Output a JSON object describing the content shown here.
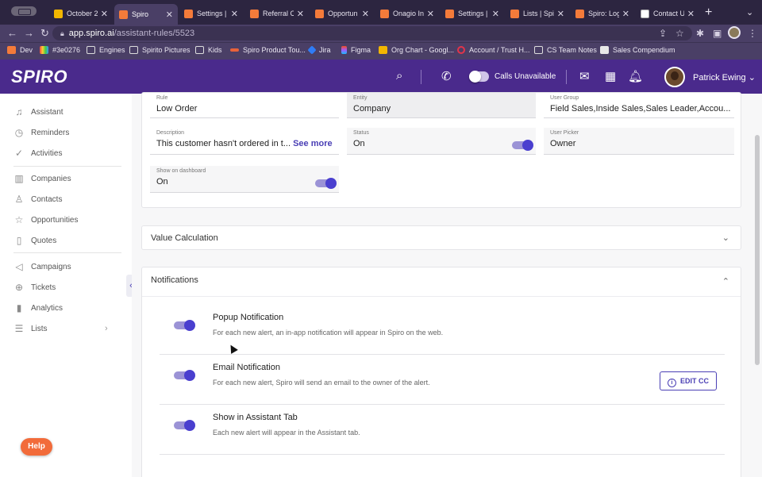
{
  "browser": {
    "tabs": [
      {
        "title": "October 2",
        "favicon": "gslide",
        "active": false
      },
      {
        "title": "Spiro",
        "favicon": "spiro",
        "active": true
      },
      {
        "title": "Settings |",
        "favicon": "spiro",
        "active": false
      },
      {
        "title": "Referral C",
        "favicon": "spiro",
        "active": false
      },
      {
        "title": "Opportun",
        "favicon": "spiro",
        "active": false
      },
      {
        "title": "Onagio In",
        "favicon": "spiro",
        "active": false
      },
      {
        "title": "Settings |",
        "favicon": "spiro",
        "active": false
      },
      {
        "title": "Lists | Spi",
        "favicon": "spiro",
        "active": false
      },
      {
        "title": "Spiro: Log",
        "favicon": "spiro",
        "active": false
      },
      {
        "title": "Contact U",
        "favicon": "page",
        "active": false
      }
    ],
    "url_host": "app.spiro.ai",
    "url_path": "/assistant-rules/5523",
    "bookmarks": [
      "Dev",
      "#3e0276",
      "Engines",
      "Spirito Pictures",
      "Kids",
      "Spiro Product Tou...",
      "Jira",
      "Figma",
      "Org Chart - Googl...",
      "Account / Trust H...",
      "CS Team Notes",
      "Sales Compendium"
    ]
  },
  "header": {
    "logo": "SPIRO",
    "calls_status": "Calls Unavailable",
    "user_name": "Patrick Ewing"
  },
  "sidebar": {
    "items": [
      {
        "label": "Assistant",
        "icon": "bell-icon"
      },
      {
        "label": "Reminders",
        "icon": "clock-icon"
      },
      {
        "label": "Activities",
        "icon": "check-circle-icon"
      },
      {
        "label": "Companies",
        "icon": "building-icon"
      },
      {
        "label": "Contacts",
        "icon": "person-icon"
      },
      {
        "label": "Opportunities",
        "icon": "star-icon"
      },
      {
        "label": "Quotes",
        "icon": "clipboard-icon"
      },
      {
        "label": "Campaigns",
        "icon": "megaphone-icon"
      },
      {
        "label": "Tickets",
        "icon": "lifebuoy-icon"
      },
      {
        "label": "Analytics",
        "icon": "bar-chart-icon"
      },
      {
        "label": "Lists",
        "icon": "list-icon"
      }
    ],
    "help_label": "Help"
  },
  "rule": {
    "rule_label": "Rule",
    "rule_value": "Low Order",
    "entity_label": "Entity",
    "entity_value": "Company",
    "user_group_label": "User Group",
    "user_group_value": "Field Sales,Inside Sales,Sales Leader,Accou...",
    "description_label": "Description",
    "description_value": "This customer hasn't ordered in t...",
    "see_more": "See more",
    "status_label": "Status",
    "status_value": "On",
    "user_picker_label": "User Picker",
    "user_picker_value": "Owner",
    "dashboard_label": "Show on dashboard",
    "dashboard_value": "On"
  },
  "sections": {
    "value_calculation": "Value Calculation",
    "notifications": "Notifications"
  },
  "notifications": [
    {
      "title": "Popup Notification",
      "desc": "For each new alert, an in-app notification will appear in Spiro on the web.",
      "enabled": true
    },
    {
      "title": "Email Notification",
      "desc": "For each new alert, Spiro will send an email to the owner of the alert.",
      "enabled": true,
      "action": "EDIT CC"
    },
    {
      "title": "Show in Assistant Tab",
      "desc": "Each new alert will appear in the Assistant tab.",
      "enabled": true
    }
  ],
  "colors": {
    "brand": "#4a2a8c",
    "accent": "#4a3fcf",
    "help": "#f26b3a"
  }
}
